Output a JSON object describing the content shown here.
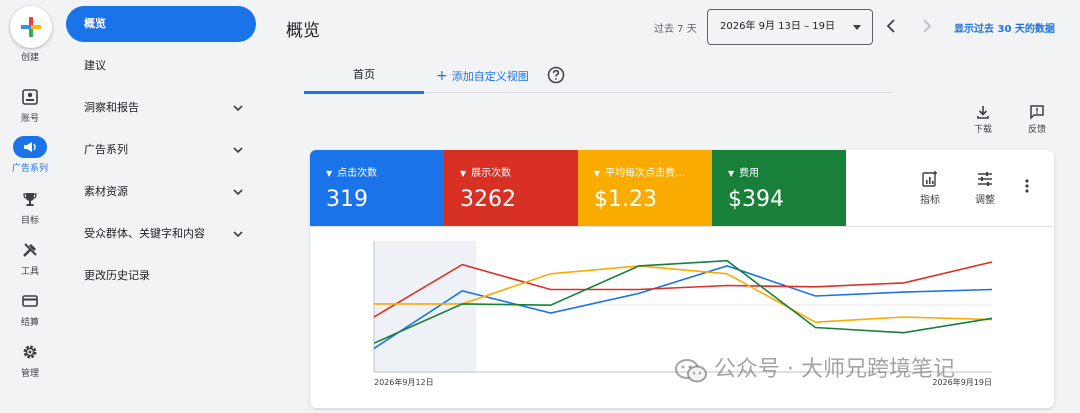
{
  "rail": {
    "create": "创建",
    "items": [
      {
        "label": "账号",
        "icon": "account-icon"
      },
      {
        "label": "广告系列",
        "icon": "megaphone-icon",
        "active": true
      },
      {
        "label": "目标",
        "icon": "trophy-icon"
      },
      {
        "label": "工具",
        "icon": "tools-icon"
      },
      {
        "label": "结算",
        "icon": "billing-icon"
      },
      {
        "label": "管理",
        "icon": "gear-icon"
      }
    ]
  },
  "nav": {
    "items": [
      {
        "label": "概览",
        "active": true
      },
      {
        "label": "建议"
      },
      {
        "label": "洞察和报告",
        "expandable": true
      },
      {
        "label": "广告系列",
        "expandable": true
      },
      {
        "label": "素材资源",
        "expandable": true
      },
      {
        "label": "受众群体、关键字和内容",
        "expandable": true
      },
      {
        "label": "更改历史记录"
      }
    ]
  },
  "header": {
    "title": "概览",
    "range_prefix": "过去 7 天",
    "date_range": "2026年 9月 13日 – 19日",
    "show_30": "显示过去 30 天的数据"
  },
  "tabs": {
    "home": "首页",
    "add_view": "添加自定义视图"
  },
  "tools": {
    "download": "下载",
    "feedback": "反馈"
  },
  "metrics": [
    {
      "label": "点击次数",
      "value": "319",
      "color": "#1a73e8"
    },
    {
      "label": "展示次数",
      "value": "3262",
      "color": "#d93025"
    },
    {
      "label": "平均每次点击费…",
      "value": "$1.23",
      "color": "#f9ab00"
    },
    {
      "label": "费用",
      "value": "$394",
      "color": "#188038"
    }
  ],
  "card_tools": {
    "metrics": "指标",
    "adjust": "调整"
  },
  "chart_data": {
    "type": "line",
    "x": [
      "2026年9月12日",
      "",
      "",
      "",
      "",
      "",
      "",
      "2026年9月19日"
    ],
    "x_start_label": "2026年9月12日",
    "x_end_label": "2026年9月19日",
    "grid": false,
    "series": [
      {
        "color": "#1a73e8",
        "values": [
          0.18,
          0.62,
          0.45,
          0.6,
          0.81,
          0.58,
          0.61,
          0.63
        ]
      },
      {
        "color": "#d93025",
        "values": [
          0.42,
          0.82,
          0.63,
          0.63,
          0.66,
          0.65,
          0.68,
          0.84
        ]
      },
      {
        "color": "#f9ab00",
        "values": [
          0.52,
          0.52,
          0.75,
          0.81,
          0.75,
          0.38,
          0.42,
          0.4
        ]
      },
      {
        "color": "#188038",
        "values": [
          0.22,
          0.52,
          0.51,
          0.81,
          0.85,
          0.34,
          0.3,
          0.41
        ]
      }
    ]
  },
  "watermark": "公众号 · 大师兄跨境笔记"
}
